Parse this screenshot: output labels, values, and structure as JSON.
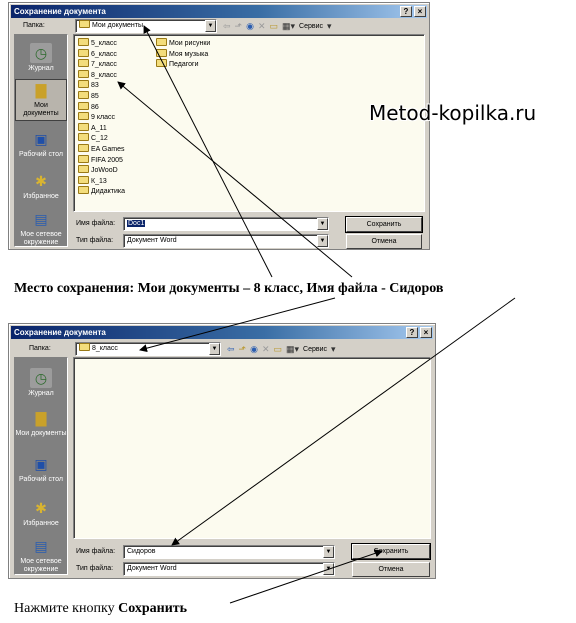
{
  "dialog1": {
    "title": "Сохранение документа",
    "help_btn": "?",
    "close_btn": "×",
    "look_in_label": "Папка:",
    "look_in_value": "Мои документы",
    "tools_label": "Сервис",
    "places": [
      "Журнал",
      "Мои документы",
      "Рабочий стол",
      "Избранное",
      "Мое сетевое окружение"
    ],
    "files_col1": [
      "5_класс",
      "6_класс",
      "7_класс",
      "8_класс",
      "83",
      "85",
      "86",
      "9 класс",
      "А_11",
      "С_12",
      "EA Games",
      "FIFA 2005",
      "JoWooD",
      "К_13",
      "Дидактика"
    ],
    "files_col2": [
      "Мои рисунки",
      "Моя музыка",
      "Педагоги"
    ],
    "filename_label": "Имя файла:",
    "filename_value": "Doc1",
    "filetype_label": "Тип файла:",
    "filetype_value": "Документ Word",
    "save_button": "Сохранить",
    "cancel_button": "Отмена"
  },
  "watermark": "Metod-kopilka.ru",
  "caption_middle": "Место сохранения: Мои документы – 8 класс, Имя файла - Сидоров",
  "dialog2": {
    "title": "Сохранение документа",
    "help_btn": "?",
    "close_btn": "×",
    "look_in_label": "Папка:",
    "look_in_value": "8_класс",
    "tools_label": "Сервис",
    "places": [
      "Журнал",
      "Мои документы",
      "Рабочий стол",
      "Избранное",
      "Мое сетевое окружение"
    ],
    "filename_label": "Имя файла:",
    "filename_value": "Сидоров",
    "filetype_label": "Тип файла:",
    "filetype_value": "Документ Word",
    "save_button": "Сохранить",
    "cancel_button": "Отмена"
  },
  "caption_bottom_prefix": "Нажмите кнопку ",
  "caption_bottom_bold": "Сохранить",
  "colors": {
    "titlebar": "#0a246a",
    "dialog_bg": "#d4d0c8",
    "list_bg": "#fcfbef",
    "folder": "#f3dd7c"
  }
}
